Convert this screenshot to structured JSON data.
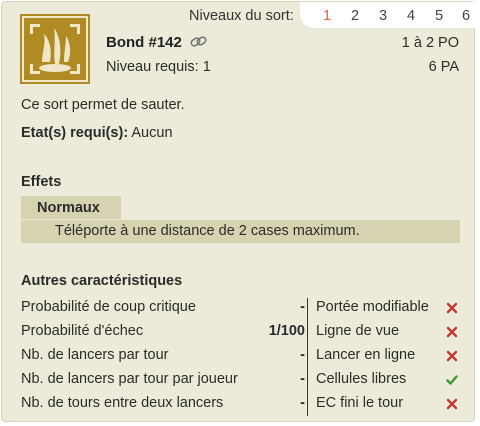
{
  "levels": {
    "label": "Niveaux du sort:",
    "items": [
      "1",
      "2",
      "3",
      "4",
      "5",
      "6"
    ],
    "active_index": 0
  },
  "spell": {
    "icon": "spell-leap-icon",
    "name": "Bond #142",
    "level_required": "Niveau requis: 1",
    "po": "1 à 2 PO",
    "pa": "6 PA",
    "description": "Ce sort permet de sauter.",
    "required_states_label": "Etat(s) requi(s):",
    "required_states_value": "Aucun"
  },
  "effects": {
    "title": "Effets",
    "tab_label": "Normaux",
    "items": [
      "Téléporte à une distance de 2 cases maximum."
    ]
  },
  "characteristics": {
    "title": "Autres caractéristiques",
    "left": [
      {
        "label": "Probabilité de coup critique",
        "value": "-"
      },
      {
        "label": "Probabilité d'échec",
        "value": "1/100"
      },
      {
        "label": "Nb. de lancers par tour",
        "value": "-"
      },
      {
        "label": "Nb. de lancers par tour par joueur",
        "value": "-"
      },
      {
        "label": "Nb. de tours entre deux lancers",
        "value": "-"
      }
    ],
    "right": [
      {
        "label": "Portée modifiable",
        "status": "no"
      },
      {
        "label": "Ligne de vue",
        "status": "no"
      },
      {
        "label": "Lancer en ligne",
        "status": "no"
      },
      {
        "label": "Cellules libres",
        "status": "yes"
      },
      {
        "label": "EC fini le tour",
        "status": "no"
      }
    ]
  },
  "colors": {
    "card_bg": "#ecebd9",
    "accent_active_level": "#e0663a",
    "effect_bg": "#d6d3b0",
    "no_mark": "#c0392b",
    "yes_mark": "#3a9a3a"
  }
}
